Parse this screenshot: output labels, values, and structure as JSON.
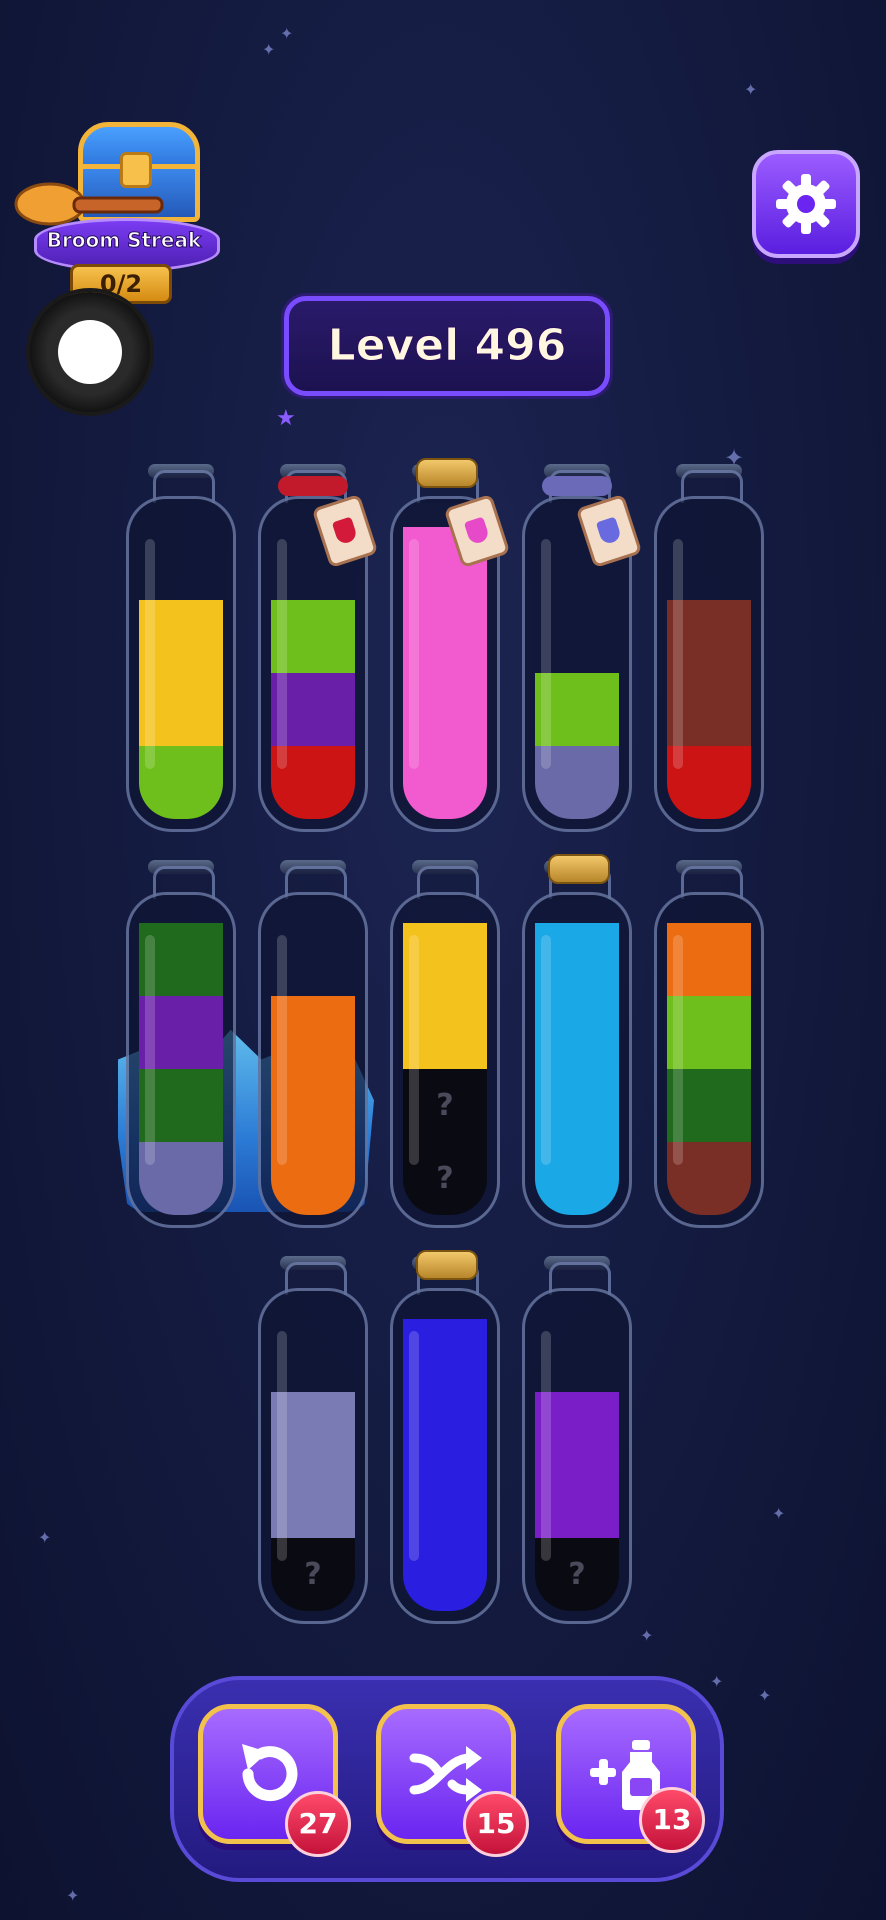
{
  "broom_streak": {
    "label": "Broom Streak",
    "count": "0/2"
  },
  "level": {
    "label": "Level 496"
  },
  "colors": {
    "yellow": "#f4c21c",
    "lime": "#6fbf1c",
    "purple": "#6a1fa8",
    "red": "#cc1414",
    "pink": "#f25ad0",
    "periwinkle": "#6a6aa8",
    "brown": "#7a2f26",
    "dark_green": "#1f6a1c",
    "orange": "#ec6c12",
    "cyan": "#1aa8e6",
    "black": "#0a0a12",
    "blue": "#2a1ee0",
    "violet": "#7a1fc8",
    "lavender": "#7a7ab4"
  },
  "tubes": [
    {
      "row": 1,
      "layers": [
        "lime",
        "yellow",
        "yellow"
      ],
      "top": "",
      "tag": ""
    },
    {
      "row": 1,
      "layers": [
        "red",
        "purple",
        "lime"
      ],
      "top": "ribbon-red",
      "tag": "red-vial"
    },
    {
      "row": 1,
      "layers": [
        "pink",
        "pink",
        "pink",
        "pink"
      ],
      "top": "cork",
      "tag": "pink-vial"
    },
    {
      "row": 1,
      "layers": [
        "periwinkle",
        "lime"
      ],
      "top": "ribbon-periwinkle",
      "tag": "blue-vial"
    },
    {
      "row": 1,
      "layers": [
        "red",
        "brown",
        "brown"
      ],
      "top": "",
      "tag": ""
    },
    {
      "row": 2,
      "layers": [
        "periwinkle",
        "dark_green",
        "purple",
        "dark_green"
      ],
      "top": "",
      "frozen": true
    },
    {
      "row": 2,
      "layers": [
        "orange",
        "orange",
        "orange"
      ],
      "top": "",
      "frozen": true
    },
    {
      "row": 2,
      "layers": [
        "unknown",
        "unknown",
        "yellow",
        "yellow"
      ],
      "top": ""
    },
    {
      "row": 2,
      "layers": [
        "cyan",
        "cyan",
        "cyan",
        "cyan"
      ],
      "top": "cork"
    },
    {
      "row": 2,
      "layers": [
        "brown",
        "dark_green",
        "lime",
        "orange"
      ],
      "top": ""
    },
    {
      "row": 3,
      "layers": [
        "unknown",
        "lavender",
        "lavender"
      ],
      "top": ""
    },
    {
      "row": 3,
      "layers": [
        "blue",
        "blue",
        "blue",
        "blue"
      ],
      "top": "cork"
    },
    {
      "row": 3,
      "layers": [
        "unknown",
        "violet",
        "violet"
      ],
      "top": ""
    }
  ],
  "unknown_mark": "?",
  "powerups": [
    {
      "name": "undo",
      "icon": "undo-icon",
      "count": "27"
    },
    {
      "name": "shuffle",
      "icon": "shuffle-icon",
      "count": "15"
    },
    {
      "name": "add-tube",
      "icon": "add-tube-icon",
      "count": "13"
    }
  ]
}
